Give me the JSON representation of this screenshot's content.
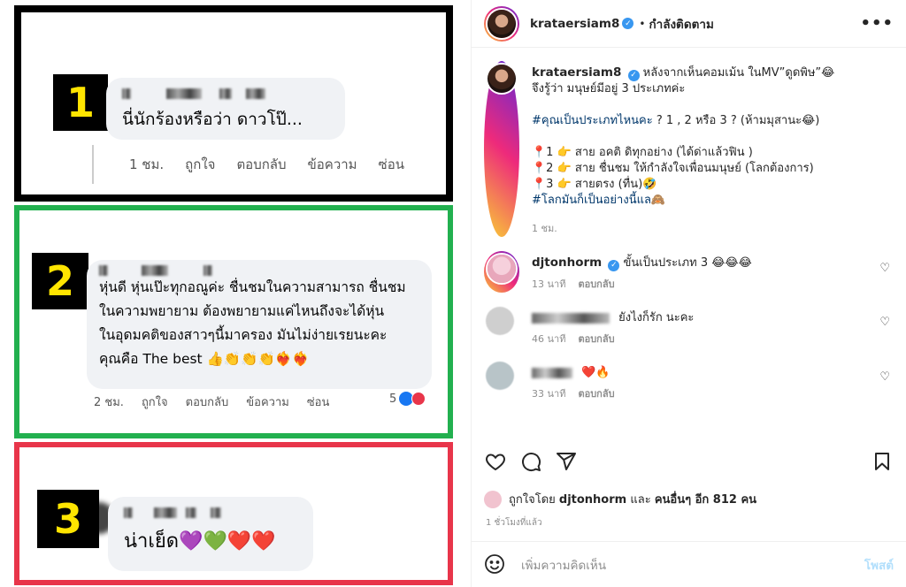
{
  "media": {
    "panel1": {
      "number": "1",
      "text": "นี่นักร้องหรือว่า ดาวโป๊...",
      "actions": [
        "1 ชม.",
        "ถูกใจ",
        "ตอบกลับ",
        "ข้อความ",
        "ซ่อน"
      ]
    },
    "panel2": {
      "number": "2",
      "text_lines": [
        "หุ่นดี หุ่นเป๊ะทุกอณูค่ะ ชื่นชมในความสามารถ ชื่นชม",
        "ในความพยายาม ต้องพยายามแค่ไหนถึงจะได้หุ่น",
        "ในอุดมคติของสาวๆนี้มาครอง มันไม่ง่ายเรยนะคะ",
        "คุณคือ The best 👍👏👏👏❤️‍🔥❤️‍🔥"
      ],
      "actions": [
        "2 ชม.",
        "ถูกใจ",
        "ตอบกลับ",
        "ข้อความ",
        "ซ่อน"
      ],
      "reactions": "5"
    },
    "panel3": {
      "number": "3",
      "text": "น่าเย็ด💜💚❤️❤️"
    },
    "colors": {
      "panel1_border": "#000000",
      "panel2_border": "#22b04f",
      "panel3_border": "#e8354a",
      "badge_text": "#ffe500"
    }
  },
  "header": {
    "username": "krataersiam8",
    "separator": "•",
    "follow_status": "กำลังติดตาม",
    "more_icon": "more-horizontal-icon"
  },
  "caption": {
    "username": "krataersiam8",
    "line1": "หลังจากเห็นคอมเม้น ในMV”ดูดพิษ”😂",
    "line2": "จึงรู้ว่า มนุษย์มีอยู่ 3 ประเภทค่ะ",
    "hashtag_q": "#คุณเป็นประเภทไหนคะ",
    "question": "? 1 , 2 หรือ 3 ? (ห้ามมุสานะ😂)",
    "items": [
      "📍1 👉 สาย อคติ ดิทุกอย่าง (ได้ด่าแล้วฟิน )",
      "📍2 👉 สาย ชื่นชม ให้กำลังใจเพื่อนมนุษย์ (โลกต้องการ)",
      "📍3 👉 สายตรง (ทื่น)🤣"
    ],
    "hashtag_end": "#โลกมันก็เป็นอย่างนี้แล🙈",
    "time": "1 ชม."
  },
  "comments": [
    {
      "username": "djtonhorm",
      "text": "ขั้นเป็นประเภท 3 😂😂😂",
      "time": "13 นาที",
      "reply": "ตอบกลับ"
    },
    {
      "username": "",
      "text": "ยังไงก็รัก นะคะ",
      "time": "46 นาที",
      "reply": "ตอบกลับ"
    },
    {
      "username": "",
      "text": "❤️🔥",
      "time": "33 นาที",
      "reply": "ตอบกลับ"
    }
  ],
  "likes": {
    "prefix": "ถูกใจโดย",
    "user": "djtonhorm",
    "and": "และ",
    "others": "คนอื่นๆ อีก 812 คน"
  },
  "time_ago": "1 ชั่วโมงที่แล้ว",
  "add_comment": {
    "placeholder": "เพิ่มความคิดเห็น",
    "post_label": "โพสต์"
  },
  "colors": {
    "hashtag": "#00376b",
    "verified": "#3897f0",
    "post_disabled": "#b2dffc"
  }
}
